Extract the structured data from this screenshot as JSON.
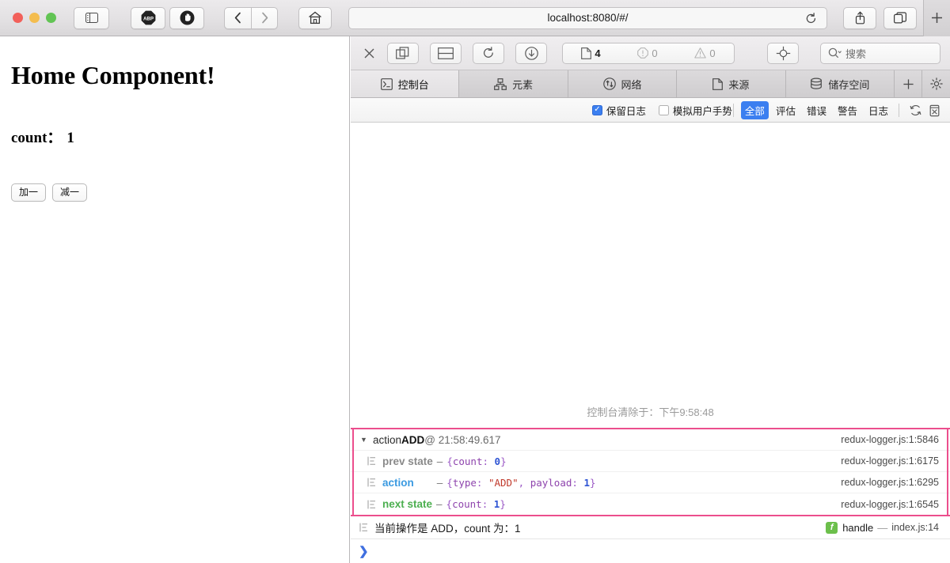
{
  "browser": {
    "url": "localhost:8080/#/",
    "buttons": {
      "sidebar": "sidebar-toggle",
      "abp": "ABP",
      "shield": "shield",
      "back": "‹",
      "forward": "›",
      "home": "home",
      "reload": "reload",
      "share": "share",
      "tabs": "tab-overview",
      "newtab": "+"
    }
  },
  "page": {
    "title": "Home Component!",
    "count_label": "count：",
    "count_value": "1",
    "buttons": [
      {
        "label": "加一",
        "name": "increment-button"
      },
      {
        "label": "减一",
        "name": "decrement-button"
      }
    ]
  },
  "devtools": {
    "toolbar": {
      "close": "×",
      "counts": {
        "messages": "4",
        "errors": "0",
        "warnings": "0"
      },
      "search_placeholder": "搜索"
    },
    "tabs": [
      {
        "label": "控制台",
        "icon": "console-icon",
        "active": true
      },
      {
        "label": "元素",
        "icon": "elements-icon",
        "active": false
      },
      {
        "label": "网络",
        "icon": "network-icon",
        "active": false
      },
      {
        "label": "来源",
        "icon": "sources-icon",
        "active": false
      },
      {
        "label": "储存空间",
        "icon": "storage-icon",
        "active": false
      }
    ],
    "tab_add": "+",
    "filterbar": {
      "preserve_log": {
        "label": "保留日志",
        "checked": true
      },
      "emulate_touch": {
        "label": "模拟用户手势",
        "checked": false
      },
      "levels": [
        {
          "label": "全部",
          "active": true
        },
        {
          "label": "评估",
          "active": false
        },
        {
          "label": "错误",
          "active": false
        },
        {
          "label": "警告",
          "active": false
        },
        {
          "label": "日志",
          "active": false
        }
      ]
    },
    "console": {
      "clear_message": "控制台清除于：下午9:58:48",
      "group": {
        "header": {
          "prefix": "action ",
          "action_name": "ADD",
          "at": " @ 21:58:49.617",
          "source": "redux-logger.js:1:5846"
        },
        "rows": [
          {
            "label": "prev state",
            "label_style": "prev",
            "dash": "–",
            "value_parts": [
              {
                "t": "{",
                "c": "brace"
              },
              {
                "t": "count",
                "c": "key"
              },
              {
                "t": ": ",
                "c": "brace"
              },
              {
                "t": "0",
                "c": "numv"
              },
              {
                "t": "}",
                "c": "brace"
              }
            ],
            "source": "redux-logger.js:1:6175"
          },
          {
            "label": "action",
            "label_style": "action",
            "dash": "–",
            "value_parts": [
              {
                "t": "{",
                "c": "brace"
              },
              {
                "t": "type",
                "c": "key"
              },
              {
                "t": ": ",
                "c": "brace"
              },
              {
                "t": "\"ADD\"",
                "c": "strv"
              },
              {
                "t": ", ",
                "c": "brace"
              },
              {
                "t": "payload",
                "c": "key"
              },
              {
                "t": ": ",
                "c": "brace"
              },
              {
                "t": "1",
                "c": "numv"
              },
              {
                "t": "}",
                "c": "brace"
              }
            ],
            "source": "redux-logger.js:1:6295"
          },
          {
            "label": "next state",
            "label_style": "next",
            "dash": "–",
            "value_parts": [
              {
                "t": "{",
                "c": "brace"
              },
              {
                "t": "count",
                "c": "key"
              },
              {
                "t": ": ",
                "c": "brace"
              },
              {
                "t": "1",
                "c": "numv"
              },
              {
                "t": "}",
                "c": "brace"
              }
            ],
            "source": "redux-logger.js:1:6545"
          }
        ],
        "highlight_color": "#ec4e8d"
      },
      "handle_log": {
        "message": "当前操作是 ADD，count 为：1",
        "fn_badge": "f",
        "fn_name": "handle",
        "dash": "—",
        "file": "index.js:14"
      },
      "prompt": "❯"
    }
  }
}
